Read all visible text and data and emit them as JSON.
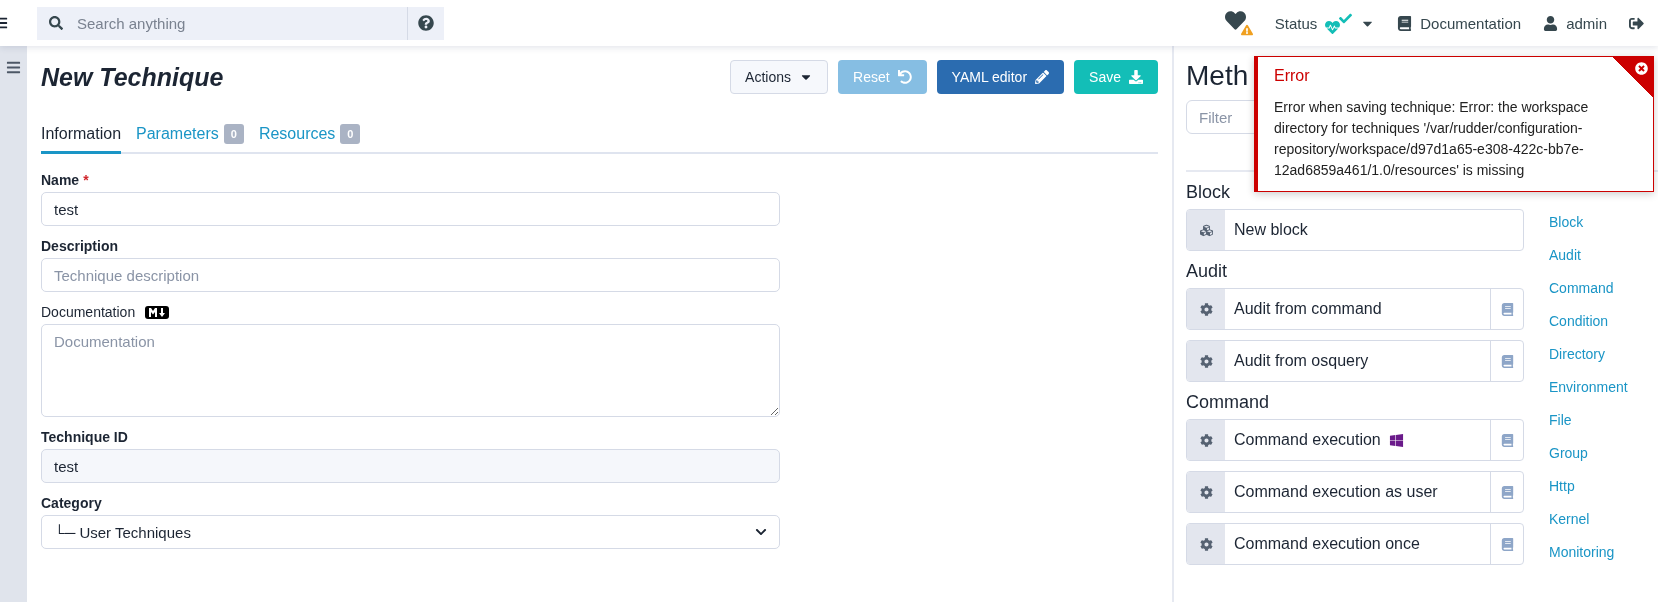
{
  "topbar": {
    "search": {
      "placeholder": "Search anything"
    },
    "status": {
      "label": "Status"
    },
    "links": [
      {
        "kind": "doc",
        "label": "Documentation"
      },
      {
        "kind": "user",
        "label": "admin"
      }
    ]
  },
  "editor": {
    "title": "New Technique",
    "actions": [
      {
        "kind": "menu",
        "label": "Actions",
        "disabled": false
      },
      {
        "kind": "reset",
        "label": "Reset",
        "disabled": true
      },
      {
        "kind": "yaml",
        "label": "YAML editor",
        "disabled": false
      },
      {
        "kind": "save",
        "label": "Save",
        "disabled": false
      }
    ],
    "tabs": [
      {
        "label": "Information",
        "selected": true
      },
      {
        "label": "Parameters",
        "count": "0",
        "selected": false
      },
      {
        "label": "Resources",
        "count": "0",
        "selected": false
      }
    ],
    "fields": [
      {
        "kind": "input",
        "label": "Name",
        "required_mark": "*",
        "value": "test"
      },
      {
        "kind": "input",
        "label": "Description",
        "placeholder": "Technique description"
      },
      {
        "kind": "textarea",
        "label": "Documentation",
        "markdown": true,
        "placeholder": "Documentation"
      },
      {
        "kind": "readonly",
        "label": "Technique ID",
        "value": "test"
      },
      {
        "kind": "select",
        "label": "Category",
        "value": "└─ User Techniques"
      }
    ]
  },
  "methods": {
    "title": "Meth",
    "filter": {
      "placeholder": "Filter"
    },
    "groups": [
      {
        "name": "Block",
        "items": [
          {
            "kind": "block",
            "label": "New block"
          }
        ]
      },
      {
        "name": "Audit",
        "items": [
          {
            "kind": "method",
            "label": "Audit from command"
          },
          {
            "kind": "method",
            "label": "Audit from osquery"
          }
        ]
      },
      {
        "name": "Command",
        "items": [
          {
            "kind": "method",
            "label": "Command execution",
            "dsc": true
          },
          {
            "kind": "method",
            "label": "Command execution as user"
          },
          {
            "kind": "method",
            "label": "Command execution once"
          }
        ]
      }
    ],
    "nav": [
      "Block",
      "Audit",
      "Command",
      "Condition",
      "Directory",
      "Environment",
      "File",
      "Group",
      "Http",
      "Kernel",
      "Monitoring"
    ]
  },
  "toast": {
    "title": "Error",
    "message": "Error when saving technique: Error: the workspace directory for techniques '/var/rudder/configuration-repository/workspace/d97d1a65-e308-422c-bb7e-12ad6859a461/1.0/resources' is missing"
  }
}
